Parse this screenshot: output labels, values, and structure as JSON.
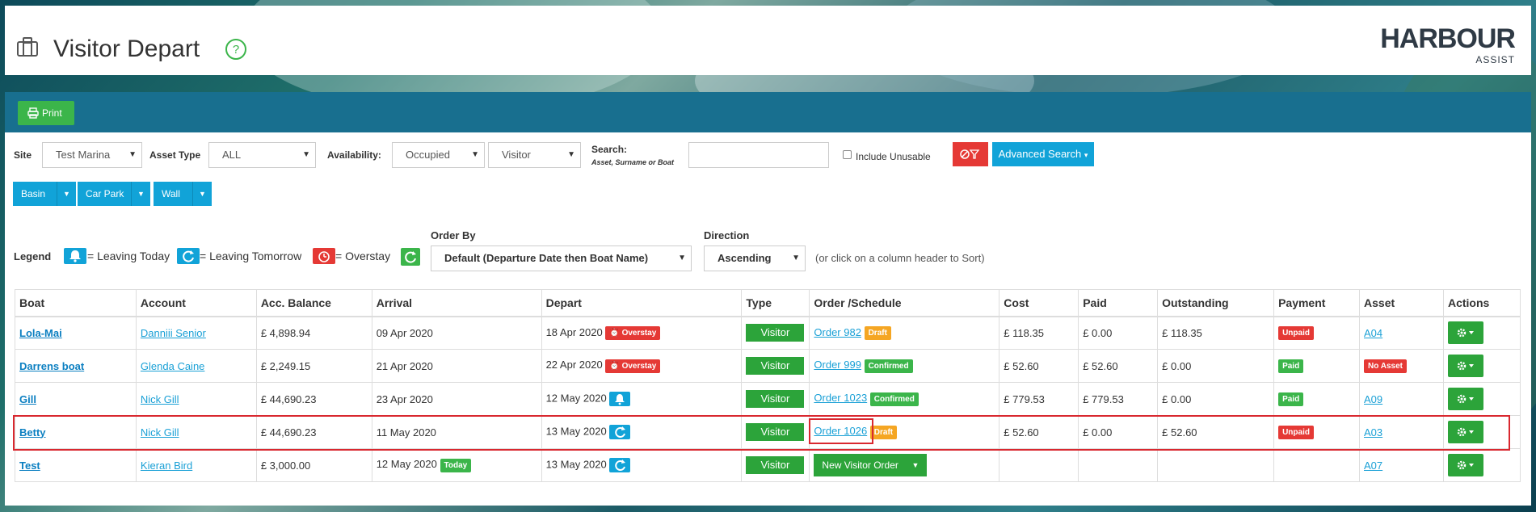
{
  "header": {
    "title": "Visitor Depart",
    "logo_main": "HARBOUR",
    "logo_sub": "ASSIST"
  },
  "toolbar": {
    "print_label": "Print"
  },
  "filters": {
    "site_label": "Site",
    "site_value": "Test Marina",
    "asset_type_label": "Asset Type",
    "asset_type_value": "ALL",
    "availability_label": "Availability:",
    "availability_value": "Occupied",
    "availability_type_value": "Visitor",
    "search_label": "Search:",
    "search_hint": "Asset, Surname or Boat",
    "search_value": "",
    "include_unusable_label": "Include Unusable",
    "advanced_search_label": "Advanced Search"
  },
  "location_buttons": [
    "Basin",
    "Car Park",
    "Wall"
  ],
  "legend": {
    "label": "Legend",
    "leaving_today": "= Leaving Today",
    "leaving_tomorrow": "= Leaving Tomorrow",
    "overstay": "= Overstay"
  },
  "sort": {
    "order_by_label": "Order By",
    "order_by_value": "Default (Departure Date then Boat Name)",
    "direction_label": "Direction",
    "direction_value": "Ascending",
    "hint": "(or click on a column header to Sort)"
  },
  "table": {
    "columns": [
      "Boat",
      "Account",
      "Acc. Balance",
      "Arrival",
      "Depart",
      "Type",
      "Order /Schedule",
      "Cost",
      "Paid",
      "Outstanding",
      "Payment",
      "Asset",
      "Actions"
    ],
    "rows": [
      {
        "boat": "Lola-Mai",
        "account": "Danniii Senior",
        "balance": "£ 4,898.94",
        "arrival": "09 Apr 2020",
        "depart": "18 Apr 2020",
        "depart_badge": "Overstay",
        "type": "Visitor",
        "order": "Order 982",
        "order_status": "Draft",
        "cost": "£ 118.35",
        "paid": "£ 0.00",
        "outstanding": "£ 118.35",
        "payment": "Unpaid",
        "asset": "A04"
      },
      {
        "boat": "Darrens boat",
        "account": "Glenda Caine",
        "balance": "£ 2,249.15",
        "arrival": "21 Apr 2020",
        "depart": "22 Apr 2020",
        "depart_badge": "Overstay",
        "type": "Visitor",
        "order": "Order 999",
        "order_status": "Confirmed",
        "cost": "£ 52.60",
        "paid": "£ 52.60",
        "outstanding": "£ 0.00",
        "payment": "Paid",
        "asset": "No Asset"
      },
      {
        "boat": "Gill",
        "account": "Nick Gill",
        "balance": "£ 44,690.23",
        "arrival": "23 Apr 2020",
        "depart": "12 May 2020",
        "depart_badge": "",
        "type": "Visitor",
        "order": "Order 1023",
        "order_status": "Confirmed",
        "cost": "£ 779.53",
        "paid": "£ 779.53",
        "outstanding": "£ 0.00",
        "payment": "Paid",
        "asset": "A09"
      },
      {
        "boat": "Betty",
        "account": "Nick Gill",
        "balance": "£ 44,690.23",
        "arrival": "11 May 2020",
        "depart": "13 May 2020",
        "depart_badge": "",
        "type": "Visitor",
        "order": "Order 1026",
        "order_status": "Draft",
        "cost": "£ 52.60",
        "paid": "£ 0.00",
        "outstanding": "£ 52.60",
        "payment": "Unpaid",
        "asset": "A03"
      },
      {
        "boat": "Test",
        "account": "Kieran Bird",
        "balance": "£ 3,000.00",
        "arrival": "12 May 2020",
        "arrival_badge": "Today",
        "depart": "13 May 2020",
        "depart_badge": "",
        "type": "Visitor",
        "new_order_label": "New Visitor Order",
        "cost": "",
        "paid": "",
        "outstanding": "",
        "payment": "",
        "asset": "A07"
      }
    ]
  },
  "colors": {
    "header_bar": "#186f8f",
    "green": "#3bb54a",
    "blue": "#11a3d8",
    "red": "#e53935",
    "orange": "#f5a623",
    "highlight": "#d9282f"
  },
  "icons": [
    "briefcase-icon",
    "help-icon",
    "printer-icon",
    "filter-clear-icon",
    "bell-icon",
    "refresh-icon",
    "alarm-clock-icon",
    "gear-icon",
    "chevron-down-icon"
  ]
}
